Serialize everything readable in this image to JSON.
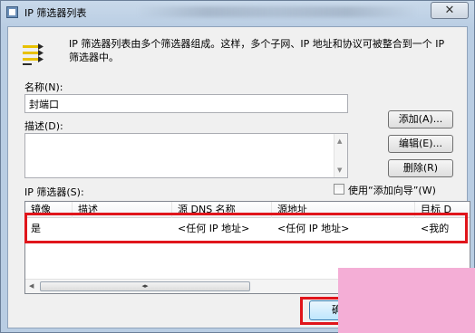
{
  "window": {
    "title": "IP 筛选器列表",
    "close_glyph": "✕"
  },
  "description": "IP 筛选器列表由多个筛选器组成。这样，多个子网、IP 地址和协议可被整合到一个 IP 筛选器中。",
  "name_field": {
    "label": "名称(N):",
    "value": "封端口"
  },
  "description_field": {
    "label": "描述(D):",
    "value": ""
  },
  "buttons": {
    "add": "添加(A)...",
    "edit": "编辑(E)...",
    "delete": "删除(R)",
    "ok": "确"
  },
  "wizard_checkbox": {
    "label": "使用“添加向导”(W)",
    "checked": false
  },
  "filters": {
    "label": "IP 筛选器(S):",
    "columns": [
      "镜像",
      "描述",
      "源 DNS 名称",
      "源地址",
      "目标 D"
    ],
    "rows": [
      [
        "是",
        "",
        "<任何 IP 地址>",
        "<任何 IP 地址>",
        "<我的"
      ]
    ]
  },
  "colors": {
    "highlight": "#e0151b",
    "overlay": "#f4aed6"
  },
  "icons": {
    "app": "ip-filter-app-icon",
    "filter": "ip-filter-icon"
  }
}
